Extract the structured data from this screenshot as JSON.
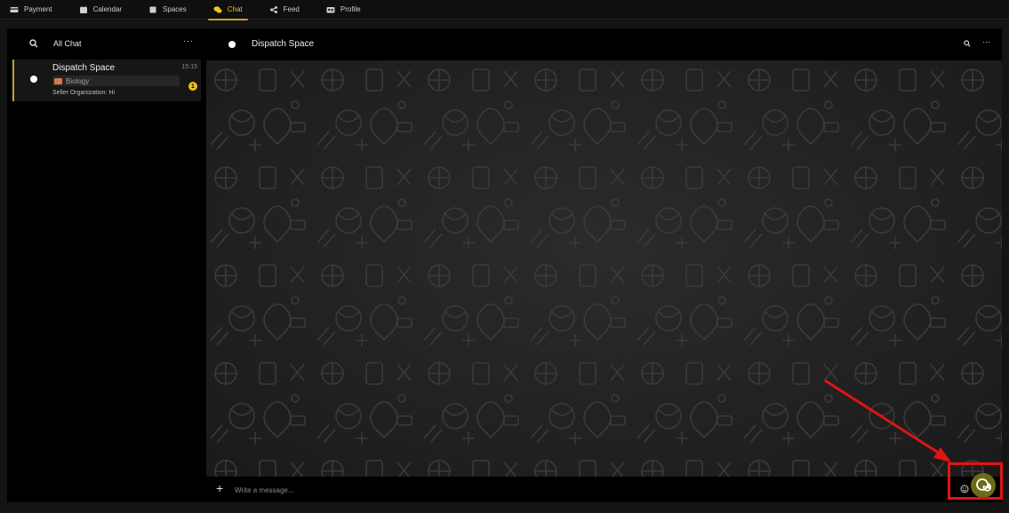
{
  "nav": {
    "items": [
      {
        "label": "Payment",
        "icon": "card-icon"
      },
      {
        "label": "Calendar",
        "icon": "calendar-icon"
      },
      {
        "label": "Spaces",
        "icon": "spaces-icon"
      },
      {
        "label": "Chat",
        "icon": "chat-icon",
        "active": true
      },
      {
        "label": "Feed",
        "icon": "share-icon"
      },
      {
        "label": "Profile",
        "icon": "id-card-icon"
      }
    ]
  },
  "sidebar": {
    "title": "All Chat",
    "more": "···",
    "chats": [
      {
        "name": "Dispatch Space",
        "time": "15:15",
        "tag": "Biology",
        "preview": "Seller Organization: Hi",
        "unread": "1"
      }
    ]
  },
  "conversation": {
    "title": "Dispatch Space",
    "more": "···",
    "composer": {
      "plus": "+",
      "placeholder": "Write a message..."
    }
  },
  "colors": {
    "accent": "#f2c21b",
    "send_button": "#6d6a1a",
    "annotation": "#e01414"
  }
}
